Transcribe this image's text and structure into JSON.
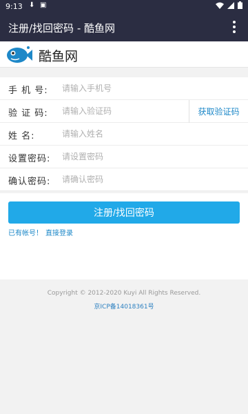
{
  "status_bar": {
    "time": "9:13",
    "icons": [
      "download-icon",
      "image-icon",
      "wifi-icon",
      "signal-icon",
      "battery-icon"
    ]
  },
  "app_bar": {
    "title": "注册/找回密码 - 酷鱼网"
  },
  "brand": {
    "name": "酷鱼网",
    "logo": "fish-logo-icon",
    "color": "#1e88c8"
  },
  "form": {
    "fields": [
      {
        "label": "手 机 号:",
        "placeholder": "请输入手机号"
      },
      {
        "label": "验 证 码:",
        "placeholder": "请输入验证码"
      },
      {
        "label": "姓 名:",
        "placeholder": "请输入姓名"
      },
      {
        "label": "设置密码:",
        "placeholder": "请设置密码"
      },
      {
        "label": "确认密码:",
        "placeholder": "请确认密码"
      }
    ],
    "sms_button": "获取验证码",
    "submit": "注册/找回密码",
    "has_account": "已有帐号！",
    "login_link": "直接登录"
  },
  "footer": {
    "copyright": "Copyright © 2012-2020 Kuyi All Rights Reserved.",
    "icp": "京ICP备14018361号"
  },
  "colors": {
    "appbar": "#2b2d42",
    "accent": "#21a9e8",
    "link": "#1e88c8"
  }
}
